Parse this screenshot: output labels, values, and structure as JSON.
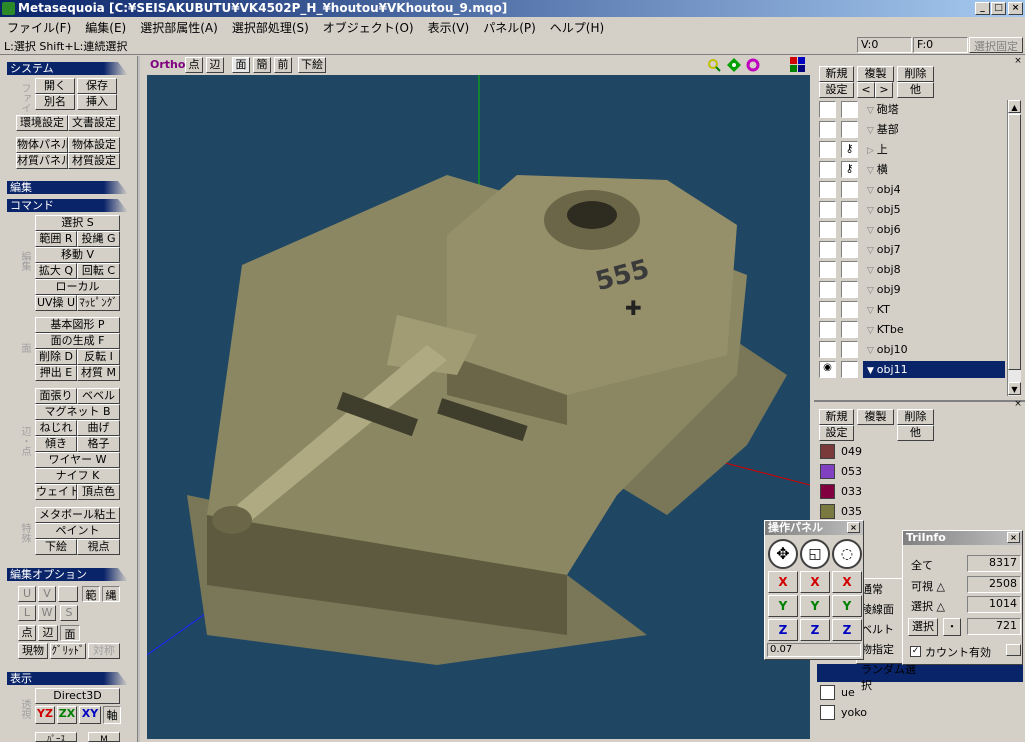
{
  "window": {
    "title": "Metasequoia [C:¥SEISAKUBUTU¥VK4502P_H_¥houtou¥VKhoutou_9.mqo]",
    "minimize": "_",
    "maximize": "□",
    "close": "×"
  },
  "menu": [
    "ファイル(F)",
    "編集(E)",
    "選択部属性(A)",
    "選択部処理(S)",
    "オブジェクト(O)",
    "表示(V)",
    "パネル(P)",
    "ヘルプ(H)"
  ],
  "status": {
    "hint": "L:選択  Shift+L:連続選択",
    "vcount": "V:0",
    "fcount": "F:0",
    "lock": "選択固定"
  },
  "left": {
    "system_header": "システム",
    "file_group": "ファイル",
    "open": "開く",
    "save": "保存",
    "saveas": "別名",
    "insert": "挿入",
    "env": "環境設定",
    "doc": "文書設定",
    "objpanel": "物体パネル",
    "objsettings": "物体設定",
    "matpanel": "材質パネル",
    "matsettings": "材質設定",
    "edit_header": "編集",
    "command_header": "コマンド",
    "edit_group": "編集",
    "select": "選択 S",
    "range": "範囲 R",
    "lasso": "投縄 G",
    "move": "移動 V",
    "scale": "拡大 Q",
    "rotate": "回転 C",
    "local": "ローカル",
    "uv": "UV操 U",
    "mapping": "ﾏｯﾋﾟﾝｸﾞ",
    "face_group": "面",
    "primitive": "基本図形 P",
    "genface": "面の生成 F",
    "delete": "削除 D",
    "flip": "反転 I",
    "extrude": "押出 E",
    "material": "材質 M",
    "vertex_group": "辺・点",
    "stretch": "面張り",
    "bevel": "ベベル",
    "magnet": "マグネット B",
    "twist": "ねじれ",
    "bend": "曲げ",
    "tilt": "傾き",
    "grid": "格子",
    "wire": "ワイヤー W",
    "knife": "ナイフ K",
    "weight": "ウェイト",
    "vcolor": "頂点色",
    "special_group": "特殊",
    "metaball": "メタボール粘土",
    "paint": "ペイント",
    "draft": "下絵",
    "viewpt": "視点",
    "editopt_header": "編集オプション",
    "u": "U",
    "v": "V",
    "range2": "範",
    "axis": "縄",
    "l": "L",
    "w": "W",
    "s": "S",
    "pt": "点",
    "edge": "辺",
    "face": "面",
    "current": "現物",
    "gridopt": "ｸﾞﾘｯﾄﾞ",
    "sym": "対称",
    "display_header": "表示",
    "view_group": "透視",
    "direct3d": "Direct3D",
    "yz": "YZ",
    "zx": "ZX",
    "xy": "XY",
    "axisbtn": "軸",
    "more1": "ﾊﾟｰｽ",
    "more2": "M"
  },
  "viewbar": {
    "ortho": "Ortho",
    "pt": "点",
    "edge": "辺",
    "face": "面",
    "simple": "簡",
    "front": "前",
    "draft": "下絵"
  },
  "objpanel": {
    "new": "新規",
    "dup": "複製",
    "del": "削除",
    "settings": "設定",
    "prev": "<",
    "next": ">",
    "other": "他",
    "items": [
      {
        "name": "砲塔",
        "lock": false,
        "arrow": "▽"
      },
      {
        "name": "基部",
        "lock": false,
        "arrow": "▽"
      },
      {
        "name": "上",
        "lock": true,
        "arrow": "▷"
      },
      {
        "name": "横",
        "lock": true,
        "arrow": "▽"
      },
      {
        "name": "obj4",
        "lock": false,
        "arrow": "▽"
      },
      {
        "name": "obj5",
        "lock": false,
        "arrow": "▽"
      },
      {
        "name": "obj6",
        "lock": false,
        "arrow": "▽"
      },
      {
        "name": "obj7",
        "lock": false,
        "arrow": "▽"
      },
      {
        "name": "obj8",
        "lock": false,
        "arrow": "▽"
      },
      {
        "name": "obj9",
        "lock": false,
        "arrow": "▽"
      },
      {
        "name": "KT",
        "lock": false,
        "arrow": "▽"
      },
      {
        "name": "KTbe",
        "lock": false,
        "arrow": "▽"
      },
      {
        "name": "obj10",
        "lock": false,
        "arrow": "▽"
      },
      {
        "name": "obj11",
        "lock": false,
        "arrow": "▼",
        "selected": true
      }
    ]
  },
  "matpanel": {
    "new": "新規",
    "dup": "複製",
    "del": "削除",
    "settings": "設定",
    "other": "他",
    "items": [
      {
        "name": "049",
        "color": "#7a3a3a"
      },
      {
        "name": "053",
        "color": "#8040c0"
      },
      {
        "name": "033",
        "color": "#800040"
      },
      {
        "name": "035",
        "color": "#7a7a40"
      }
    ],
    "bottom": [
      {
        "name": "ue",
        "color": "#ffffff"
      },
      {
        "name": "yoko",
        "color": "#ffffff"
      }
    ]
  },
  "dropdown": {
    "items": [
      "通常",
      "稜線面",
      "ベルト",
      "物指定",
      "ランダム選択"
    ]
  },
  "opspanel": {
    "title": "操作パネル",
    "close": "×",
    "x": "X",
    "y": "Y",
    "z": "Z",
    "value": "0.07"
  },
  "triinfo": {
    "title": "TriInfo",
    "close": "×",
    "all_label": "全て",
    "all": "8317",
    "visible_label": "可視 △",
    "visible": "2508",
    "selected_label": "選択 △",
    "selected": "1014",
    "sel_btn": "選択",
    "dot": "・",
    "sel_count": "721",
    "count_label": "カウント有効"
  },
  "colors": {
    "titlebar": "#0a246a",
    "viewport": "#1f4763",
    "selected": "#0a246a"
  }
}
